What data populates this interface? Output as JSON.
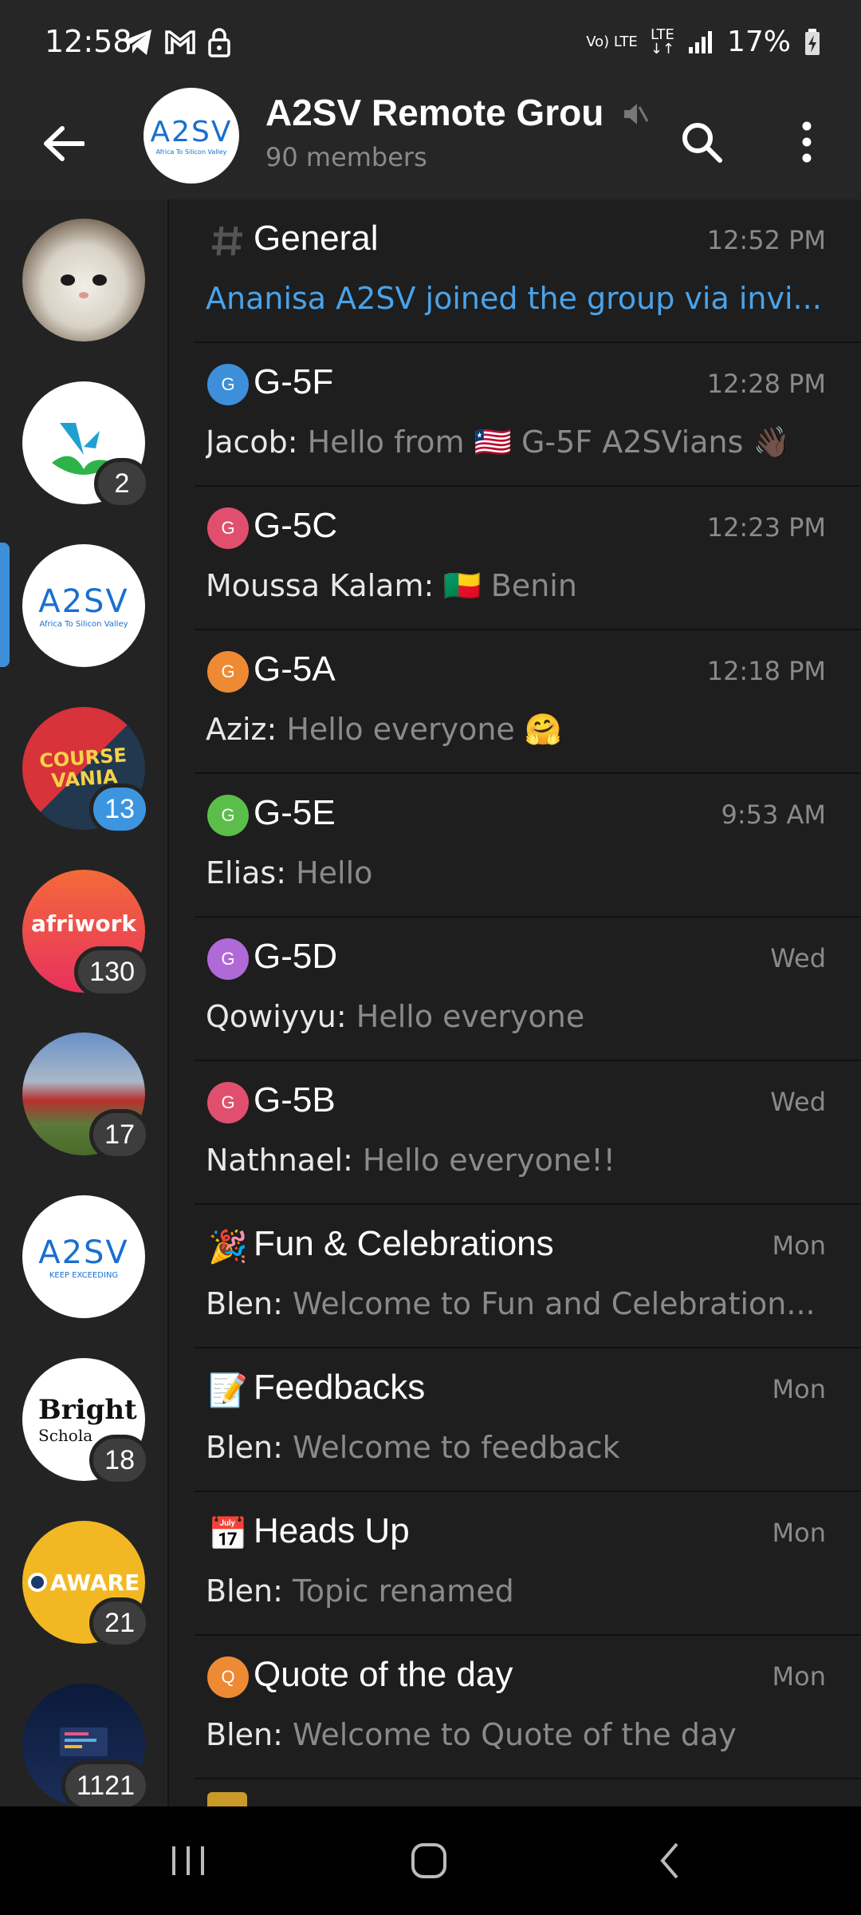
{
  "status_bar": {
    "time": "12:58",
    "battery": "17%",
    "network": "Vo) LTE",
    "lte": "LTE"
  },
  "header": {
    "title": "A2SV Remote Grou",
    "subtitle": "90 members",
    "avatar_text": "A2SV",
    "avatar_sub": "Africa To Silicon Valley"
  },
  "sidebar": {
    "items": [
      {
        "badge": ""
      },
      {
        "badge": "2"
      },
      {
        "badge": "",
        "logo": "A2SV",
        "sub": "Africa To Silicon Valley"
      },
      {
        "badge": "13",
        "logo": "COURSE VANIA"
      },
      {
        "badge": "130",
        "logo": "afriwork"
      },
      {
        "badge": "17"
      },
      {
        "badge": "",
        "logo": "A2SV",
        "sub": "KEEP EXCEEDING"
      },
      {
        "badge": "18",
        "logo": "Bright",
        "sub": "Schola"
      },
      {
        "badge": "21",
        "logo": "AWARE"
      },
      {
        "badge": "1121"
      }
    ]
  },
  "topics": [
    {
      "title": "General",
      "time": "12:52 PM",
      "sender": "",
      "message": "Ananisa A2SV joined the group via invi...",
      "icon": "hash-icon",
      "color": ""
    },
    {
      "title": "G-5F",
      "time": "12:28 PM",
      "sender": "Jacob: ",
      "message": "Hello from 🇱🇷 G-5F A2SVians 👋🏿",
      "icon": "topic-icon",
      "color": "#3d8fd9"
    },
    {
      "title": "G-5C",
      "time": "12:23 PM",
      "sender": "Moussa Kalam: ",
      "message": "🇧🇯 Benin",
      "icon": "topic-icon",
      "color": "#e0506e"
    },
    {
      "title": "G-5A",
      "time": "12:18 PM",
      "sender": "Aziz: ",
      "message": "Hello everyone 🤗",
      "icon": "topic-icon",
      "color": "#ef8a34"
    },
    {
      "title": "G-5E",
      "time": "9:53 AM",
      "sender": "Elias: ",
      "message": "Hello",
      "icon": "topic-icon",
      "color": "#5cbe4a"
    },
    {
      "title": "G-5D",
      "time": "Wed",
      "sender": "Qowiyyu: ",
      "message": "Hello everyone",
      "icon": "topic-icon",
      "color": "#b06ad8"
    },
    {
      "title": "G-5B",
      "time": "Wed",
      "sender": "Nathnael: ",
      "message": "Hello everyone!!",
      "icon": "topic-icon",
      "color": "#e0506e"
    },
    {
      "title": "Fun & Celebrations",
      "time": "Mon",
      "sender": "Blen: ",
      "message": "Welcome to Fun and Celebration...",
      "icon": "party-popper-icon",
      "color": ""
    },
    {
      "title": "Feedbacks",
      "time": "Mon",
      "sender": "Blen: ",
      "message": "Welcome to feedback",
      "icon": "memo-icon",
      "color": ""
    },
    {
      "title": "Heads Up",
      "time": "Mon",
      "sender": "Blen: ",
      "message": "Topic renamed",
      "icon": "calendar-icon",
      "color": ""
    },
    {
      "title": "Quote of the day",
      "time": "Mon",
      "sender": "Blen: ",
      "message": "Welcome to Quote of the day",
      "icon": "topic-icon",
      "color": "#ef8a34"
    }
  ],
  "topic_initial": "G",
  "quote_initial": "Q",
  "colors": {
    "accent": "#3d8fd9",
    "background": "#1e1e1e",
    "header": "#262626"
  }
}
